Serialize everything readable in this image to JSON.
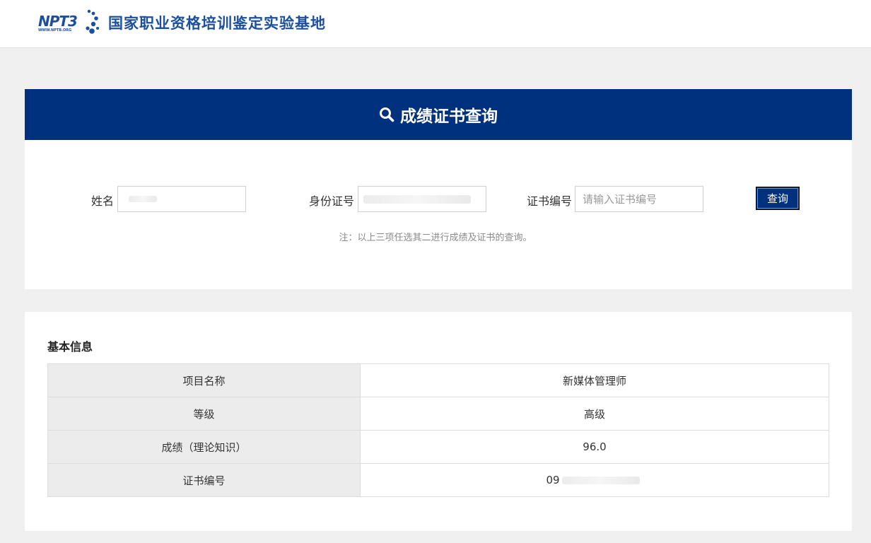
{
  "header": {
    "logo_text": "NPT3",
    "logo_subtext": "WWW.NPTB.ORG",
    "site_title": "国家职业资格培训鉴定实验基地"
  },
  "query": {
    "banner_title": "成绩证书查询",
    "name_label": "姓名",
    "name_value": "",
    "id_label": "身份证号",
    "id_value": "",
    "cert_label": "证书编号",
    "cert_placeholder": "请输入证书编号",
    "button_label": "查询",
    "note": "注：以上三项任选其二进行成绩及证书的查询。"
  },
  "info": {
    "section_title": "基本信息",
    "rows": [
      {
        "key": "项目名称",
        "value": "新媒体管理师"
      },
      {
        "key": "等级",
        "value": "高级"
      },
      {
        "key": "成绩（理论知识）",
        "value": "96.0"
      },
      {
        "key": "证书编号",
        "value": "09"
      }
    ]
  },
  "colors": {
    "brand_blue": "#00317e",
    "logo_blue": "#1e4f9c",
    "page_bg": "#f0f0f0"
  }
}
